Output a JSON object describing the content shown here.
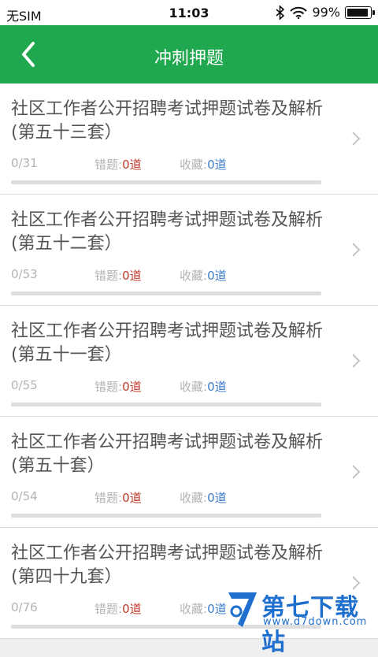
{
  "status_bar": {
    "carrier": "无SIM",
    "time": "11:03",
    "battery": "99%",
    "battery_level": 0.99
  },
  "nav": {
    "title": "冲刺押题"
  },
  "items": [
    {
      "title": "社区工作者公开招聘考试押题试卷及解析(第五十三套）",
      "count": "0/31",
      "wrong_label": "错题:",
      "wrong_value": "0道",
      "fav_label": "收藏:",
      "fav_value": "0道",
      "progress": 0
    },
    {
      "title": "社区工作者公开招聘考试押题试卷及解析(第五十二套）",
      "count": "0/53",
      "wrong_label": "错题:",
      "wrong_value": "0道",
      "fav_label": "收藏:",
      "fav_value": "0道",
      "progress": 0
    },
    {
      "title": "社区工作者公开招聘考试押题试卷及解析(第五十一套）",
      "count": "0/55",
      "wrong_label": "错题:",
      "wrong_value": "0道",
      "fav_label": "收藏:",
      "fav_value": "0道",
      "progress": 0
    },
    {
      "title": "社区工作者公开招聘考试押题试卷及解析(第五十套）",
      "count": "0/54",
      "wrong_label": "错题:",
      "wrong_value": "0道",
      "fav_label": "收藏:",
      "fav_value": "0道",
      "progress": 0
    },
    {
      "title": "社区工作者公开招聘考试押题试卷及解析(第四十九套）",
      "count": "0/76",
      "wrong_label": "错题:",
      "wrong_value": "0道",
      "fav_label": "收藏:",
      "fav_value": "0道",
      "progress": 0
    }
  ],
  "watermark": {
    "name": "第七下载站",
    "url": "www.d7down.com"
  },
  "colors": {
    "accent": "#20a84f",
    "wrong": "#c0392b",
    "fav": "#3d7cc9"
  }
}
